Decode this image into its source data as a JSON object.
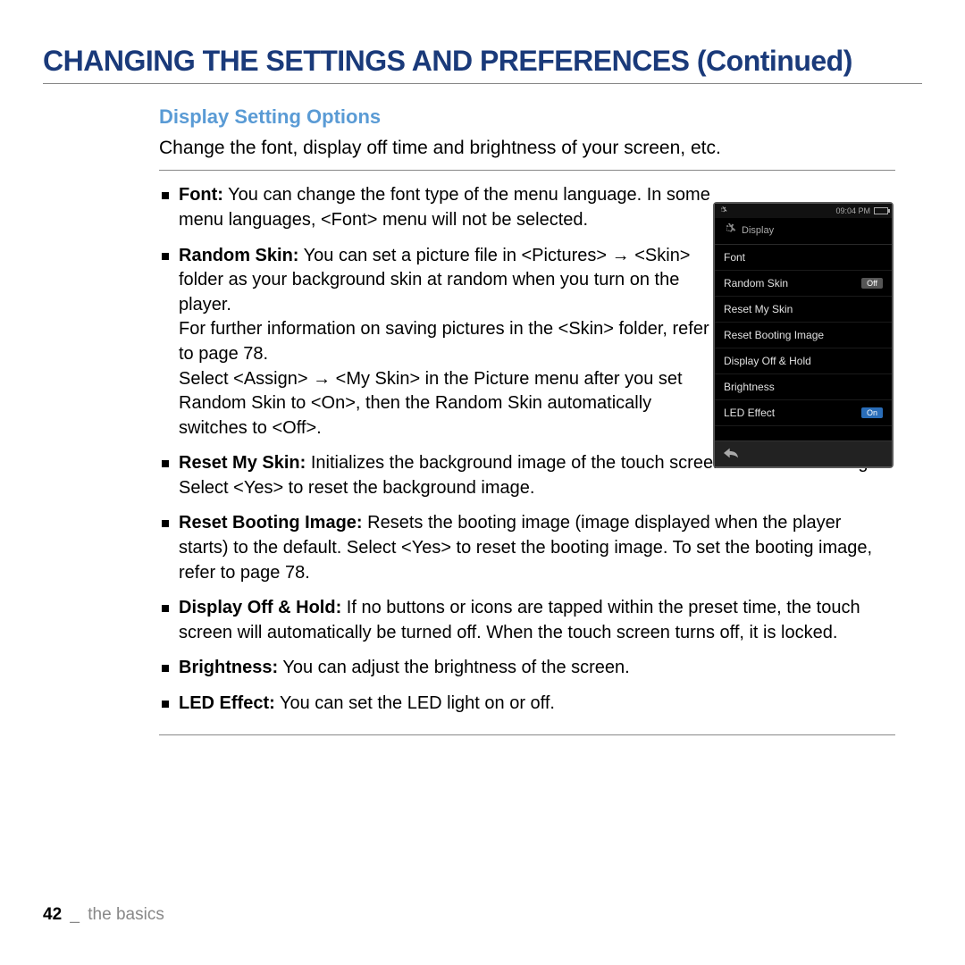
{
  "title": "CHANGING THE SETTINGS AND PREFERENCES (Continued)",
  "section": {
    "title": "Display Setting Options",
    "intro": "Change the font, display off time and brightness of your screen, etc."
  },
  "bullets": [
    {
      "label": "Font:",
      "text": " You can change the font type of the menu language. In some menu languages, <Font> menu will not be selected."
    },
    {
      "label": "Random Skin:",
      "text": " You can set a picture file in <Pictures> → <Skin> folder as your background skin at random when you turn on the player.\nFor further information on saving pictures in the <Skin> folder, refer to page 78.\nSelect <Assign> → <My Skin> in the Picture menu after you set Random Skin to <On>, then the Random Skin automatically switches to <Off>."
    },
    {
      "label": "Reset My Skin:",
      "text": " Initializes the background image of the touch screen to its default image. Select <Yes> to reset the background image."
    },
    {
      "label": "Reset Booting Image:",
      "text": " Resets the booting image (image displayed when the player starts) to the default. Select <Yes> to reset the booting image. To set the booting image, refer to page 78."
    },
    {
      "label": "Display Off & Hold:",
      "text": " If no buttons or icons are tapped within the preset time, the touch screen will automatically be turned off. When the touch screen turns off, it is locked."
    },
    {
      "label": "Brightness:",
      "text": " You can adjust the brightness of the screen."
    },
    {
      "label": "LED Effect:",
      "text": " You can set the LED light on or off."
    }
  ],
  "device": {
    "time": "09:04 PM",
    "header": "Display",
    "items": [
      {
        "label": "Font"
      },
      {
        "label": "Random Skin",
        "badge": "Off",
        "badge_kind": "off"
      },
      {
        "label": "Reset My Skin"
      },
      {
        "label": "Reset Booting Image"
      },
      {
        "label": "Display Off & Hold"
      },
      {
        "label": "Brightness"
      },
      {
        "label": "LED Effect",
        "badge": "On",
        "badge_kind": "on"
      }
    ]
  },
  "footer": {
    "page": "42",
    "sep": "_",
    "section": "the basics"
  }
}
